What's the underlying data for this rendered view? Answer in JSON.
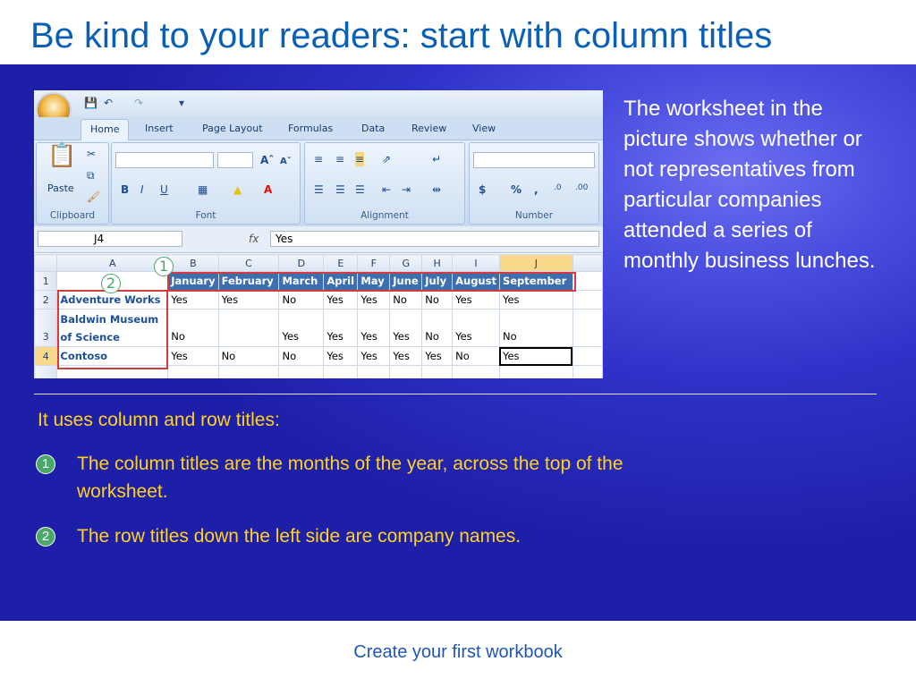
{
  "slide": {
    "title": "Be kind to your readers: start with column titles",
    "footer": "Create your first workbook",
    "side_text": "The worksheet in the picture shows whether or not representatives from particular companies attended a series of monthly business lunches.",
    "lead": "It uses column and row titles:",
    "points": [
      {
        "num": "1",
        "text": "The column titles are the months of the year, across the top of the worksheet."
      },
      {
        "num": "2",
        "text": "The row titles down the left side are company names."
      }
    ]
  },
  "excel": {
    "tabs": [
      "Home",
      "Insert",
      "Page Layout",
      "Formulas",
      "Data",
      "Review",
      "View"
    ],
    "groups": [
      "Clipboard",
      "Font",
      "Alignment",
      "Number"
    ],
    "paste_label": "Paste",
    "name_box": "J4",
    "fx_label": "fx",
    "formula_value": "Yes",
    "columns": [
      "A",
      "B",
      "C",
      "D",
      "E",
      "F",
      "G",
      "H",
      "I",
      "J"
    ],
    "months": [
      "January",
      "February",
      "March",
      "April",
      "May",
      "June",
      "July",
      "August",
      "September"
    ],
    "rows": [
      {
        "num": "1"
      },
      {
        "num": "2",
        "company": "Adventure Works",
        "values": [
          "Yes",
          "Yes",
          "No",
          "Yes",
          "Yes",
          "No",
          "No",
          "Yes",
          "Yes"
        ]
      },
      {
        "num": "3",
        "company_line1": "Baldwin Museum",
        "company_line2": "of Science",
        "values": [
          "No",
          "",
          "Yes",
          "Yes",
          "Yes",
          "Yes",
          "No",
          "Yes",
          "No"
        ]
      },
      {
        "num": "4",
        "company": "Contoso",
        "values": [
          "Yes",
          "No",
          "No",
          "Yes",
          "Yes",
          "Yes",
          "Yes",
          "No",
          "Yes"
        ]
      }
    ],
    "callouts": [
      "1",
      "2"
    ]
  }
}
